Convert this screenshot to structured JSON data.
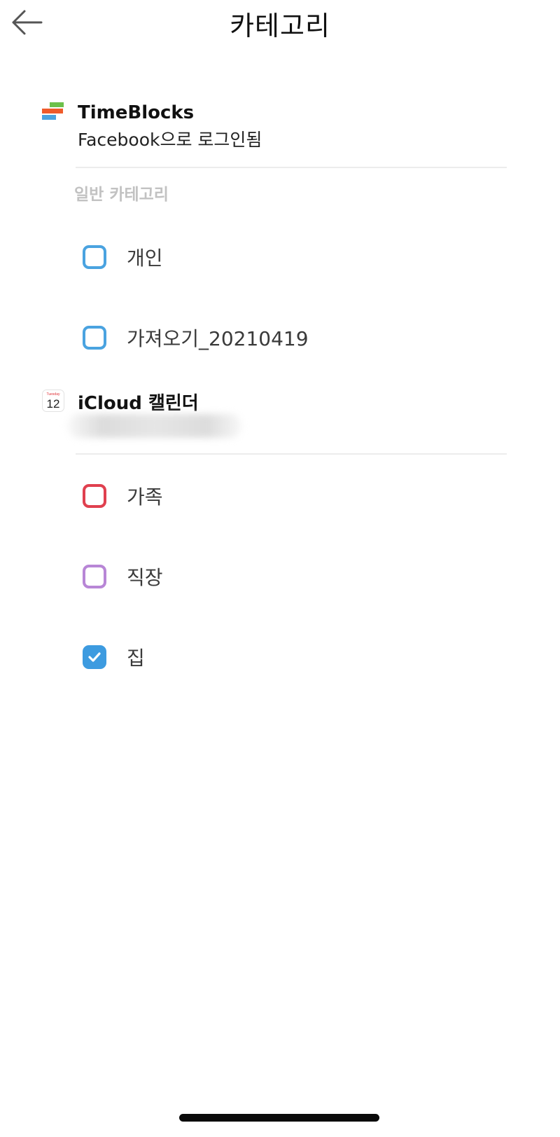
{
  "header": {
    "title": "카테고리",
    "back_icon": "arrow-left-icon"
  },
  "accounts": [
    {
      "name": "TimeBlocks",
      "subtitle": "Facebook으로 로그인됨",
      "logo_icon": "timeblocks-logo-icon",
      "section_label": "일반 카테고리",
      "categories": [
        {
          "label": "개인",
          "checked": false,
          "color": "#4aa3e0"
        },
        {
          "label": "가져오기_20210419",
          "checked": false,
          "color": "#4aa3e0"
        }
      ]
    },
    {
      "name": "iCloud 캘린더",
      "logo_icon": "calendar-app-icon",
      "logo_text": "12",
      "logo_day": "Tuesday",
      "categories": [
        {
          "label": "가족",
          "checked": false,
          "color": "#e0404f"
        },
        {
          "label": "직장",
          "checked": false,
          "color": "#b886d6"
        },
        {
          "label": "집",
          "checked": true,
          "color": "#3d9be0"
        }
      ]
    }
  ]
}
